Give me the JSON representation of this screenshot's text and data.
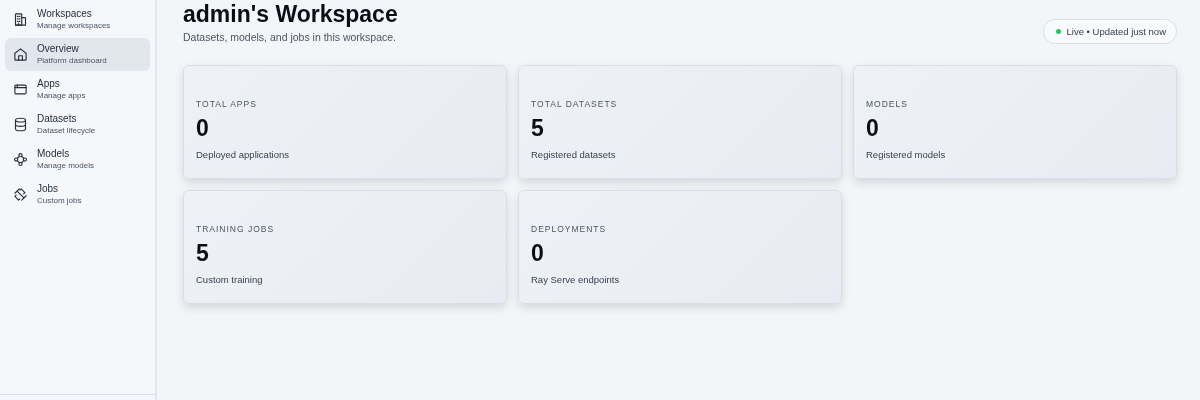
{
  "sidebar": {
    "items": [
      {
        "label": "Workspaces",
        "description": "Manage workspaces",
        "selected": false
      },
      {
        "label": "Overview",
        "description": "Platform dashboard",
        "selected": true
      },
      {
        "label": "Apps",
        "description": "Manage apps",
        "selected": false
      },
      {
        "label": "Datasets",
        "description": "Dataset lifecycle",
        "selected": false
      },
      {
        "label": "Models",
        "description": "Manage models",
        "selected": false
      },
      {
        "label": "Jobs",
        "description": "Custom jobs",
        "selected": false
      }
    ]
  },
  "header": {
    "title": "admin's Workspace",
    "subtitle": "Datasets, models, and jobs in this workspace.",
    "status": {
      "text": "Live • Updated just now",
      "color": "#22c55e"
    }
  },
  "stats": [
    {
      "label": "TOTAL APPS",
      "value": "0",
      "description": "Deployed applications"
    },
    {
      "label": "TOTAL DATASETS",
      "value": "5",
      "description": "Registered datasets"
    },
    {
      "label": "MODELS",
      "value": "0",
      "description": "Registered models"
    },
    {
      "label": "TRAINING JOBS",
      "value": "5",
      "description": "Custom training"
    },
    {
      "label": "DEPLOYMENTS",
      "value": "0",
      "description": "Ray Serve endpoints"
    }
  ]
}
